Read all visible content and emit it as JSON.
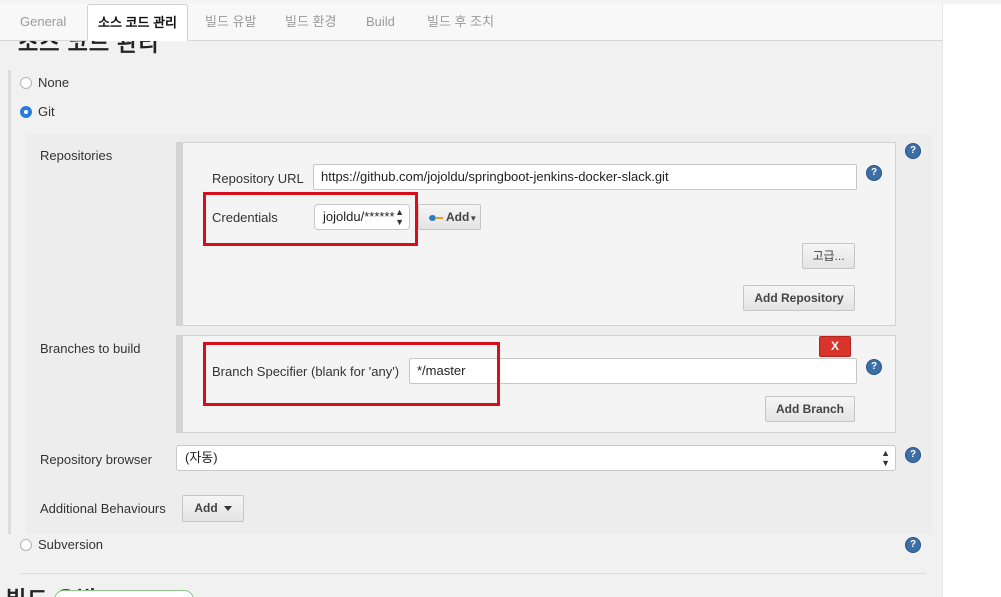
{
  "section": {
    "title": "소스 코드 관리",
    "next_title": "빌드 유발"
  },
  "tabs": [
    {
      "label": "General"
    },
    {
      "label": "소스 코드 관리"
    },
    {
      "label": "빌드 유발"
    },
    {
      "label": "빌드 환경"
    },
    {
      "label": "Build"
    },
    {
      "label": "빌드 후 조치"
    }
  ],
  "scm": {
    "none_label": "None",
    "git_label": "Git",
    "svn_label": "Subversion",
    "selected": "Git"
  },
  "git": {
    "repositories_label": "Repositories",
    "repository_url_label": "Repository URL",
    "repository_url_value": "https://github.com/jojoldu/springboot-jenkins-docker-slack.git",
    "credentials_label": "Credentials",
    "credentials_value": "jojoldu/******",
    "add_credentials_label": "Add",
    "advanced_label": "고급...",
    "add_repository_label": "Add Repository",
    "branches_label": "Branches to build",
    "branch_specifier_label": "Branch Specifier (blank for 'any')",
    "branch_specifier_value": "*/master",
    "delete_branch_label": "X",
    "add_branch_label": "Add Branch",
    "repo_browser_label": "Repository browser",
    "repo_browser_value": "(자동)",
    "additional_behaviours_label": "Additional Behaviours",
    "add_behaviour_label": "Add"
  },
  "help_icon_text": "?",
  "colors": {
    "highlight_border": "#d6101b",
    "radio_checked": "#2a7ddc",
    "help_icon": "#3d6fa6",
    "delete_button": "#d9342b"
  }
}
